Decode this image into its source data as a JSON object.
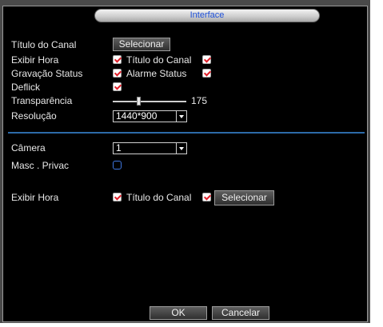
{
  "dialog": {
    "title": "Interface"
  },
  "channel": {
    "title_label": "Título do Canal",
    "select_button": "Selecionar"
  },
  "options": {
    "show_time_label": "Exibir Hora",
    "show_time_checked": true,
    "channel_title_label": "Título do Canal",
    "channel_title_checked": true,
    "record_status_label": "Gravação Status",
    "record_status_checked": true,
    "alarm_status_label": "Alarme Status",
    "alarm_status_checked": true,
    "deflick_label": "Deflick",
    "deflick_checked": true,
    "transparency_label": "Transparência",
    "transparency_value": "175",
    "transparency_fraction": 0.35,
    "resolution_label": "Resolução",
    "resolution_value": "1440*900"
  },
  "camera_section": {
    "camera_label": "Câmera",
    "camera_value": "1",
    "privacy_mask_label": "Masc . Privac",
    "privacy_mask_checked": false,
    "show_time_label": "Exibir Hora",
    "show_time_checked": true,
    "channel_title_label": "Título do Canal",
    "channel_title_checked": true,
    "select_button": "Selecionar"
  },
  "footer": {
    "ok_button": "OK",
    "cancel_button": "Cancelar"
  },
  "colors": {
    "title_text": "#1d4fd8",
    "divider": "#2c6aa8",
    "check_mark": "#e0202a"
  }
}
